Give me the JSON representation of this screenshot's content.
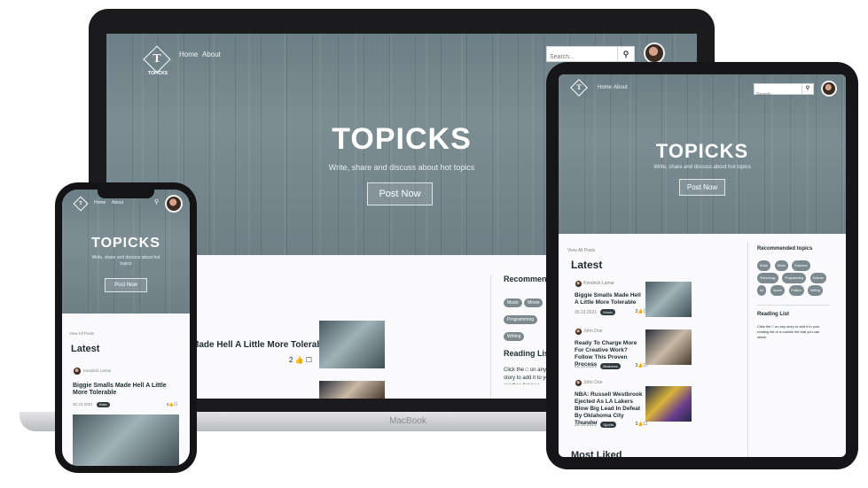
{
  "brand": {
    "name": "TOPICKS",
    "logo_letter": "T",
    "logo_caption": "TOPICKS",
    "tagline": "Write, share and discuss about hot topics",
    "post_button": "Post Now"
  },
  "nav": {
    "home": "Home",
    "about": "About"
  },
  "search": {
    "placeholder": "Search..."
  },
  "laptop": {
    "base_label": "MacBook",
    "sidebar_title": "Recommended topics",
    "tags": [
      "Music",
      "Movie",
      "Programming",
      "Writing"
    ],
    "reading_title": "Reading List",
    "reading_text": "Click the □ on any story to add it to your reading list or a",
    "latest_partial_title": "Made Hell A Little More Tolerable",
    "likes": "2"
  },
  "tablet": {
    "view_all": "View All Posts",
    "latest": "Latest",
    "sidebar_title": "Recommended topics",
    "tags": [
      "Music",
      "Movie",
      "Business",
      "Technology",
      "Programming",
      "Science",
      "Art",
      "Sports",
      "Politics",
      "Writing"
    ],
    "reading_title": "Reading List",
    "reading_text": "Click the □ on any story to add it to your reading list or a custom list that you can share.",
    "posts": [
      {
        "author": "Kendrick Lamar",
        "title": "Biggie Smalls Made Hell A Little More Tolerable",
        "date": "30.10.2021",
        "tag": "Music",
        "likes": "2"
      },
      {
        "author": "John Doe",
        "title": "Ready To Charge More For Creative Work? Follow This Proven Process",
        "date": "29.10.2021",
        "tag": "Business",
        "likes": "3"
      },
      {
        "author": "John Doe",
        "title": "NBA: Russell Westbrook Ejected As LA Lakers Blow Big Lead In Defeat By Oklahoma City Thunder",
        "date": "28.10.2021",
        "tag": "Sports",
        "likes": "3"
      }
    ],
    "most_liked": "Most Liked"
  },
  "phone": {
    "view_all": "View All Posts",
    "latest": "Latest",
    "post": {
      "author": "Kendrick Lamar",
      "title": "Biggie Smalls Made Hell A Little More Tolerable",
      "date": "30.10.2021",
      "tag": "Music",
      "likes": "2"
    }
  }
}
